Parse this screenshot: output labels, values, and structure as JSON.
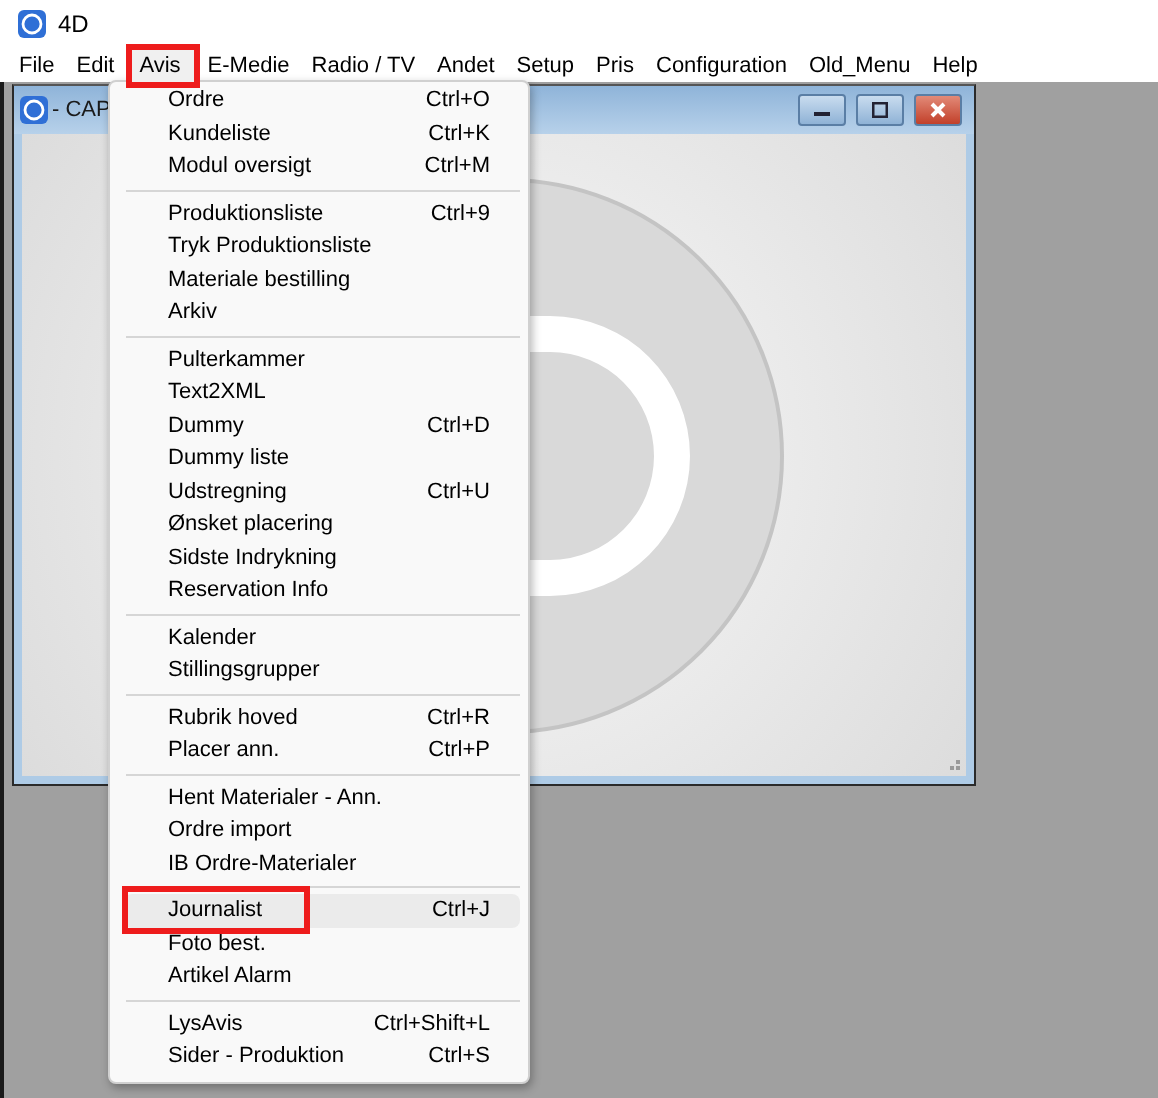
{
  "app": {
    "title": "4D"
  },
  "menubar": [
    {
      "label": "File",
      "selected": false,
      "highlighted": false
    },
    {
      "label": "Edit",
      "selected": false,
      "highlighted": false
    },
    {
      "label": "Avis",
      "selected": true,
      "highlighted": true
    },
    {
      "label": "E-Medie",
      "selected": false,
      "highlighted": false
    },
    {
      "label": "Radio / TV",
      "selected": false,
      "highlighted": false
    },
    {
      "label": "Andet",
      "selected": false,
      "highlighted": false
    },
    {
      "label": "Setup",
      "selected": false,
      "highlighted": false
    },
    {
      "label": "Pris",
      "selected": false,
      "highlighted": false
    },
    {
      "label": "Configuration",
      "selected": false,
      "highlighted": false
    },
    {
      "label": "Old_Menu",
      "selected": false,
      "highlighted": false
    },
    {
      "label": "Help",
      "selected": false,
      "highlighted": false
    }
  ],
  "document_window": {
    "title": "- CAP"
  },
  "menu": {
    "groups": [
      {
        "items": [
          {
            "label": "Ordre",
            "shortcut": "Ctrl+O",
            "selected": false,
            "highlighted": false
          },
          {
            "label": "Kundeliste",
            "shortcut": "Ctrl+K",
            "selected": false,
            "highlighted": false
          },
          {
            "label": "Modul oversigt",
            "shortcut": "Ctrl+M",
            "selected": false,
            "highlighted": false
          }
        ]
      },
      {
        "items": [
          {
            "label": "Produktionsliste",
            "shortcut": "Ctrl+9",
            "selected": false,
            "highlighted": false
          },
          {
            "label": "Tryk Produktionsliste",
            "selected": false,
            "highlighted": false
          },
          {
            "label": "Materiale bestilling",
            "selected": false,
            "highlighted": false
          },
          {
            "label": "Arkiv",
            "selected": false,
            "highlighted": false
          }
        ]
      },
      {
        "items": [
          {
            "label": "Pulterkammer",
            "selected": false,
            "highlighted": false
          },
          {
            "label": "Text2XML",
            "selected": false,
            "highlighted": false
          },
          {
            "label": "Dummy",
            "shortcut": "Ctrl+D",
            "selected": false,
            "highlighted": false
          },
          {
            "label": "Dummy liste",
            "selected": false,
            "highlighted": false
          },
          {
            "label": "Udstregning",
            "shortcut": "Ctrl+U",
            "selected": false,
            "highlighted": false
          },
          {
            "label": "Ønsket placering",
            "selected": false,
            "highlighted": false
          },
          {
            "label": "Sidste Indrykning",
            "selected": false,
            "highlighted": false
          },
          {
            "label": "Reservation Info",
            "selected": false,
            "highlighted": false
          }
        ]
      },
      {
        "items": [
          {
            "label": "Kalender",
            "selected": false,
            "highlighted": false
          },
          {
            "label": "Stillingsgrupper",
            "selected": false,
            "highlighted": false
          }
        ]
      },
      {
        "items": [
          {
            "label": "Rubrik hoved",
            "shortcut": "Ctrl+R",
            "selected": false,
            "highlighted": false
          },
          {
            "label": "Placer ann.",
            "shortcut": "Ctrl+P",
            "selected": false,
            "highlighted": false
          }
        ]
      },
      {
        "items": [
          {
            "label": "Hent Materialer - Ann.",
            "selected": false,
            "highlighted": false
          },
          {
            "label": "Ordre import",
            "selected": false,
            "highlighted": false
          },
          {
            "label": "IB Ordre-Materialer",
            "selected": false,
            "highlighted": false
          }
        ]
      },
      {
        "items": [
          {
            "label": "Journalist",
            "shortcut": "Ctrl+J",
            "selected": true,
            "highlighted": true
          },
          {
            "label": "Foto best.",
            "selected": false,
            "highlighted": false
          },
          {
            "label": "Artikel Alarm",
            "selected": false,
            "highlighted": false
          }
        ]
      },
      {
        "items": [
          {
            "label": "LysAvis",
            "shortcut": "Ctrl+Shift+L",
            "selected": false,
            "highlighted": false
          },
          {
            "label": "Sider - Produktion",
            "shortcut": "Ctrl+S",
            "selected": false,
            "highlighted": false
          }
        ]
      }
    ]
  }
}
